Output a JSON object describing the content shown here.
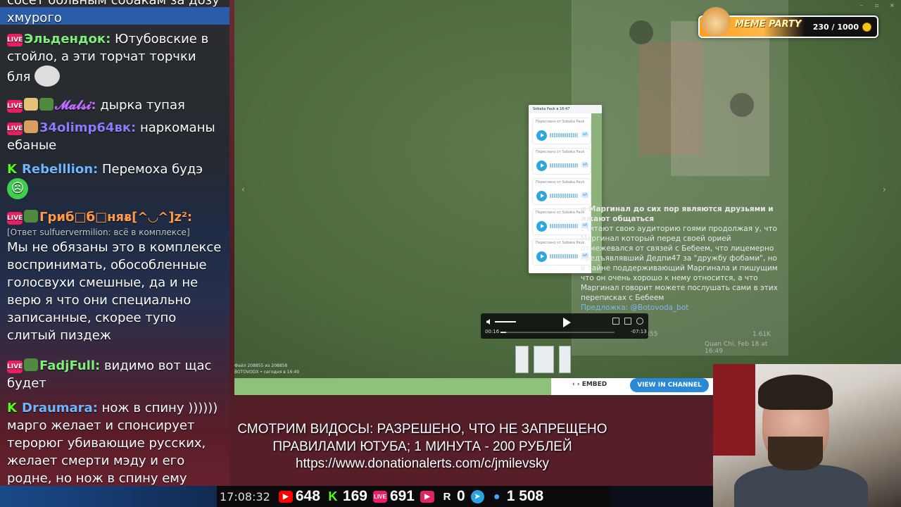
{
  "chat": {
    "messages": [
      {
        "user": "",
        "text": "сосет больным собакам за дозу хмурого"
      },
      {
        "user": "Эльдендок:",
        "text": "Ютубовские в стойло, а эти торчат торчки бля"
      },
      {
        "user": "𝓜𝓪𝓵𝓼𝓲:",
        "text": "дырка тупая"
      },
      {
        "user": "34olimp64вк:",
        "text": "наркоманы ебаные"
      },
      {
        "user": "Rebelllion:",
        "text": "Перемоха будэ"
      },
      {
        "user": "Гриб□б□няᴃ[^◡^]z²:",
        "reply": "[Ответ sulfuervermilion: всё в комплексе]",
        "text": "Мы не обязаны это в комплексе воспринимать, обособленные голосвухи смешные, да и не верю я что они специально записанные, скорее тупо слитый пиздеж"
      },
      {
        "user": "FadjFull:",
        "text": "видимо вот щас будет"
      },
      {
        "user": "Draumara:",
        "text": "нож в спину )))))) марго желает и спонсирует терорюг убивающие русских, желает смерти мэду и его родне, но нож в спину ему всадили"
      }
    ]
  },
  "viewer": {
    "phone_header": "Sobaka Pauk в 16:47",
    "voice_fwd": "Переслано от Sobaka Pauk",
    "voice_aa": "аА",
    "post_title": "и Маргинал до сих пор являются друзьями и лжают общаться",
    "post_body": "считают свою аудиторию гоями продолжая у, что Маргинал который перед своей орией отмежевался от связей с Бебеем, что лицемерно предъявлявший Дедпи47 за \"дружбу фобами\", но в тайне поддерживающий Маргинала и пишущим что он очень хорошо к нему относится, а что Маргинал говорит можете послушать сами в этих переписках с Бебеем",
    "post_preview": "Предложка: @Botovoda_bot",
    "post_link": "/311355",
    "post_views": "1.61K",
    "post_meta": "Quan Chi, Feb 18 at 16:49",
    "time_current": "00:16",
    "time_remaining": "-07:13",
    "progress_fraction": 0.05,
    "file_info_1": "Файл 208855 из 208858",
    "file_info_2": "BOTOVODX • сегодня в 16:49",
    "embed_label": "EMBED",
    "view_channel_label": "VIEW IN CHANNEL"
  },
  "meme_party": {
    "title": "MEME PARTY",
    "count": "230 / 1000"
  },
  "caption": {
    "line1": "СМОТРИМ ВИДОСЫ: РАЗРЕШЕНО, ЧТО НЕ ЗАПРЕЩЕНО",
    "line2": "ПРАВИЛАМИ ЮТУБА; 1 МИНУТА - 200 РУБЛЕЙ",
    "line3": "https://www.donationalerts.com/c/jmilevsky"
  },
  "stats": {
    "time": "17:08:32",
    "youtube": "648",
    "kick": "169",
    "vk_live": "691",
    "rutube": "",
    "r_count": "0",
    "viewers": "1 508"
  },
  "colors": {
    "accent_blue": "#2a88d8",
    "kick_green": "#53fc18",
    "live_pink": "#e91e63",
    "youtube_red": "#ff0000"
  }
}
